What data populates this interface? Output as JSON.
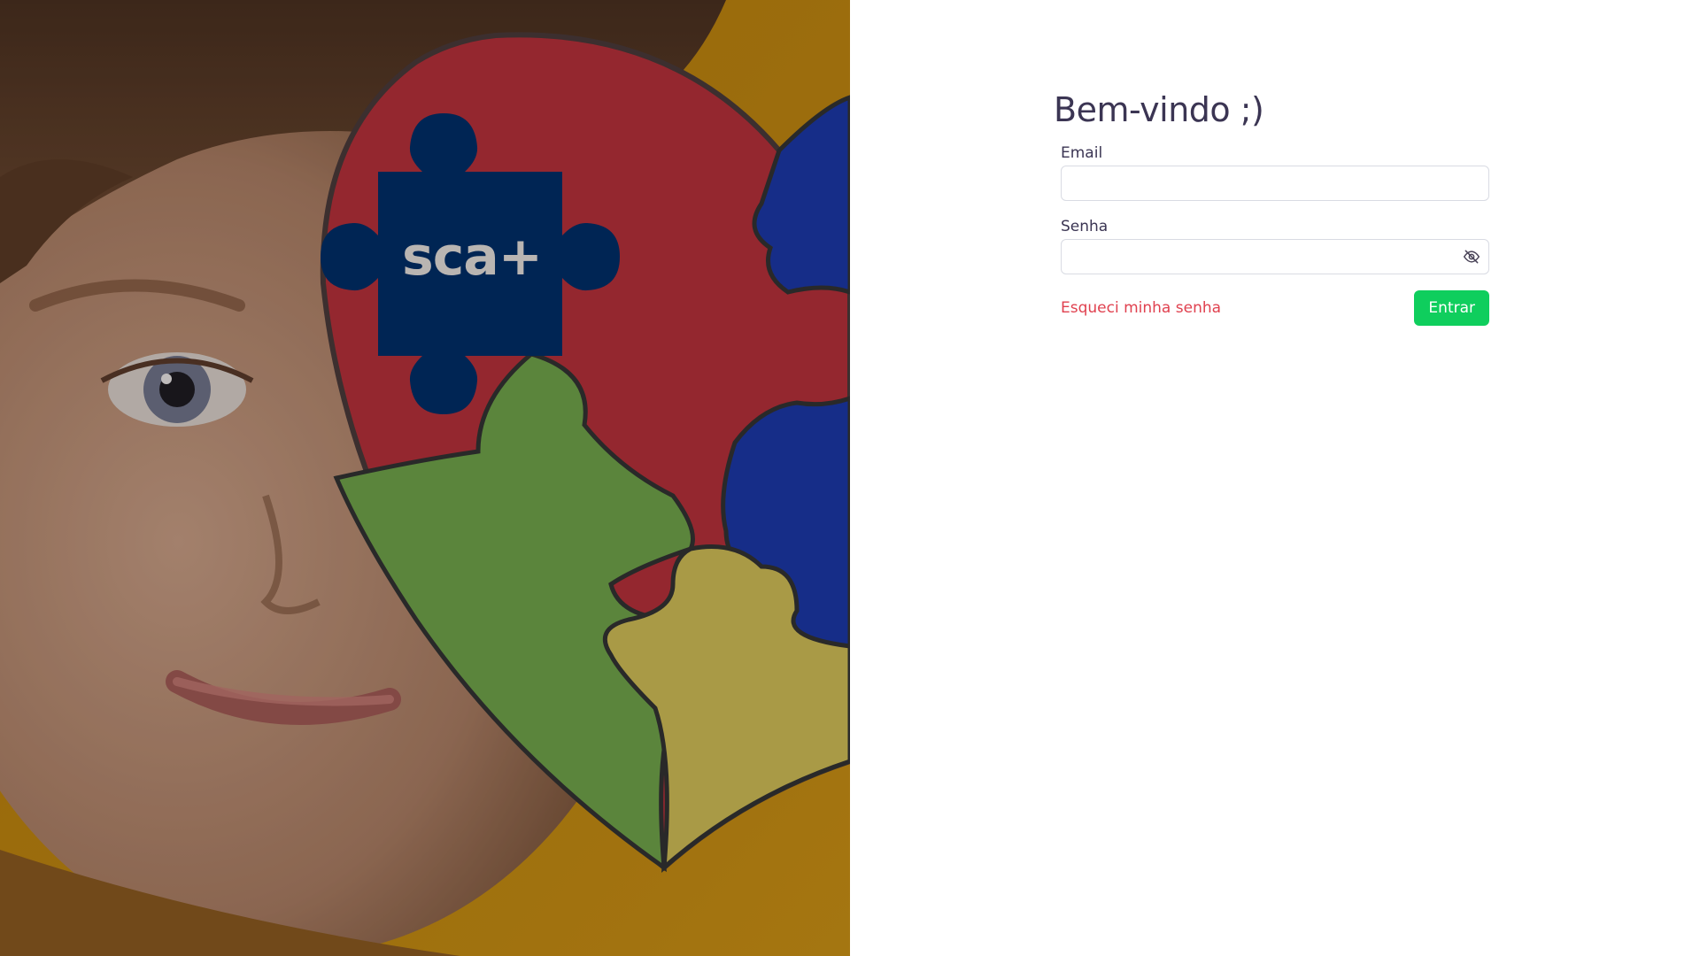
{
  "hero": {
    "logo_text": "sca+",
    "logo_color": "#002554",
    "background_color": "#c58a12"
  },
  "login": {
    "title": "Bem-vindo ;)",
    "email": {
      "label": "Email",
      "value": "",
      "placeholder": ""
    },
    "password": {
      "label": "Senha",
      "value": "",
      "placeholder": "",
      "toggle_icon": "eye-slash-icon"
    },
    "forgot_password_label": "Esqueci minha senha",
    "submit_label": "Entrar"
  },
  "colors": {
    "title_text": "#3b3553",
    "link": "#e0414f",
    "primary_button": "#0fce5d",
    "input_border": "#d9dbe3"
  }
}
